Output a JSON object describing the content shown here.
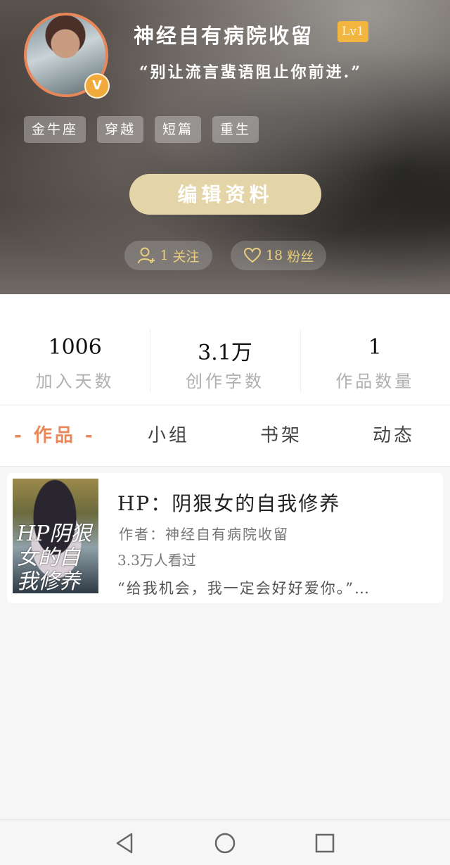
{
  "profile": {
    "username": "神经自有病院收留",
    "level": "Lv1",
    "vip_mark": "V",
    "motto": "“别让流言蜚语阻止你前进.”",
    "tags": [
      "金牛座",
      "穿越",
      "短篇",
      "重生"
    ],
    "edit_label": "编辑资料",
    "follow": {
      "count": "1",
      "label": "关注"
    },
    "fans": {
      "count": "18",
      "label": "粉丝"
    }
  },
  "stats": [
    {
      "value": "1006",
      "label": "加入天数"
    },
    {
      "value": "3.1万",
      "label": "创作字数"
    },
    {
      "value": "1",
      "label": "作品数量"
    }
  ],
  "tabs": [
    {
      "label": "- 作品 -",
      "active": true
    },
    {
      "label": "小组",
      "active": false
    },
    {
      "label": "书架",
      "active": false
    },
    {
      "label": "动态",
      "active": false
    }
  ],
  "works": [
    {
      "title": "HP：阴狠女的自我修养",
      "author": "作者：神经自有病院收留",
      "reads": "3.3万人看过",
      "quote": "“给我机会，我一定会好好爱你。”…",
      "cover_text": "HP阴狠女的自我修养"
    }
  ],
  "colors": {
    "accent": "#e8875a",
    "level_badge": "#f2b540",
    "edit_button": "#e4d5a8",
    "pill_text": "#e9cf7e"
  },
  "icons": {
    "follow": "person-add-icon",
    "fans": "heart-icon",
    "nav_back": "triangle-back-icon",
    "nav_home": "circle-home-icon",
    "nav_recent": "square-recent-icon"
  }
}
